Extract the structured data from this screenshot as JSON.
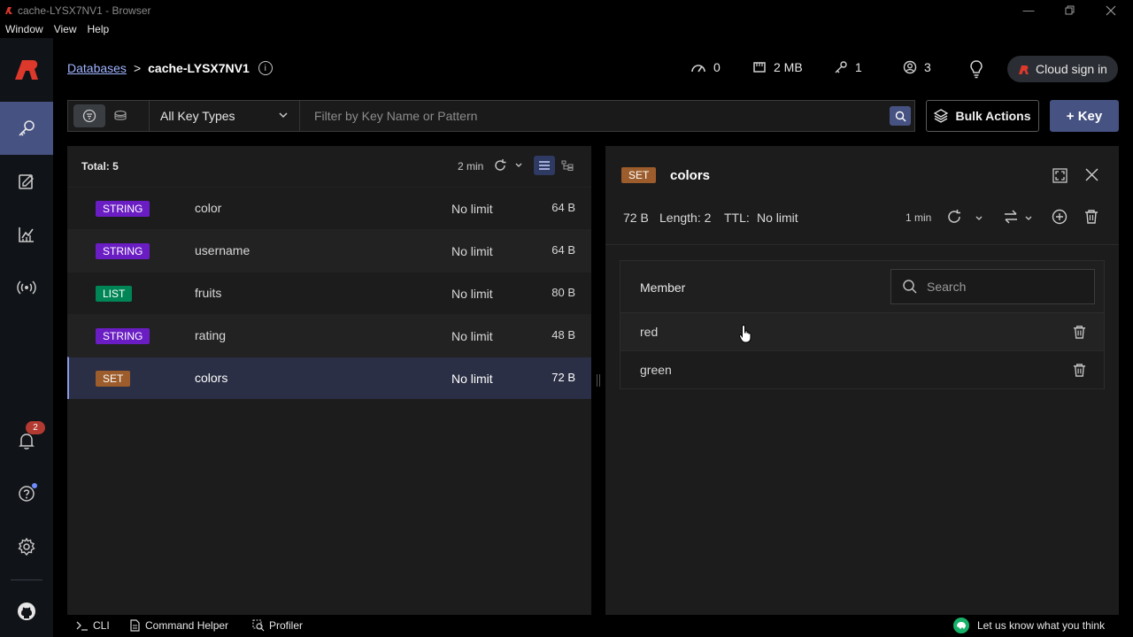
{
  "window": {
    "title": "cache-LYSX7NV1 - Browser",
    "menu": [
      "Window",
      "View",
      "Help"
    ]
  },
  "colors": {
    "accent": "#465282",
    "string_badge": "#6a1dc3",
    "list_badge": "#008556",
    "set_badge": "#9c5c2b",
    "brand": "#dc382c"
  },
  "header": {
    "breadcrumb_link": "Databases",
    "breadcrumb_sep": ">",
    "database_name": "cache-LYSX7NV1",
    "stats": {
      "ops": "0",
      "memory": "2 MB",
      "keys": "1",
      "clients": "3"
    },
    "cloud_signin": "Cloud sign in"
  },
  "filters": {
    "key_type": "All Key Types",
    "search_placeholder": "Filter by Key Name or Pattern",
    "bulk_actions": "Bulk Actions",
    "add_key": "+ Key"
  },
  "keylist": {
    "total": "Total: 5",
    "refresh_time": "2 min",
    "keys": [
      {
        "type": "STRING",
        "name": "color",
        "ttl": "No limit",
        "size": "64 B"
      },
      {
        "type": "STRING",
        "name": "username",
        "ttl": "No limit",
        "size": "64 B"
      },
      {
        "type": "LIST",
        "name": "fruits",
        "ttl": "No limit",
        "size": "80 B"
      },
      {
        "type": "STRING",
        "name": "rating",
        "ttl": "No limit",
        "size": "48 B"
      },
      {
        "type": "SET",
        "name": "colors",
        "ttl": "No limit",
        "size": "72 B"
      }
    ]
  },
  "detail": {
    "type": "SET",
    "key": "colors",
    "size": "72 B",
    "length": "Length: 2",
    "ttl_label": "TTL:",
    "ttl_value": "No limit",
    "refresh_time": "1 min",
    "column": "Member",
    "search_placeholder": "Search",
    "members": [
      "red",
      "green"
    ]
  },
  "nav": {
    "notifications_count": "2"
  },
  "bottombar": {
    "cli": "CLI",
    "command_helper": "Command Helper",
    "profiler": "Profiler",
    "feedback": "Let us know what you think"
  }
}
